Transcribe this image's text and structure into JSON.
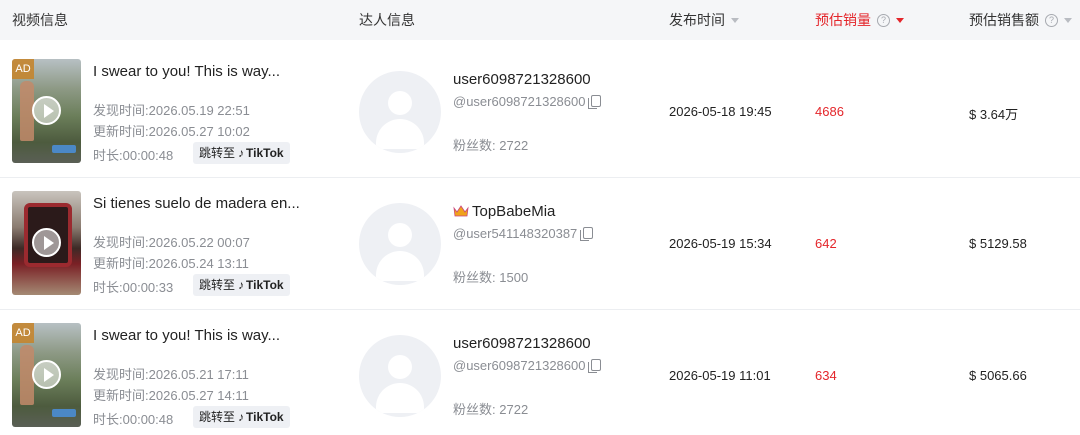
{
  "header": {
    "video_info": "视频信息",
    "creator_info": "达人信息",
    "publish_time": "发布时间",
    "est_sales": "预估销量",
    "est_gmv": "预估销售额",
    "help_icon": "question-circle-icon",
    "sort_icon": "caret-down-icon",
    "accent_color": "#e4262b"
  },
  "rows": [
    {
      "ad_badge": "AD",
      "title": "I swear to you! This is way...",
      "found_label": "发现时间:",
      "found_time": "2026.05.19 22:51",
      "updated_label": "更新时间:",
      "updated_time": "2026.05.27 10:02",
      "duration_label": "时长:",
      "duration": "00:00:48",
      "jump_label": "跳转至",
      "tiktok_label": "TikTok",
      "creator_name": "user6098721328600",
      "creator_id": "@user6098721328600",
      "fans_label": "粉丝数:",
      "fans": "2722",
      "publish_time": "2026-05-18 19:45",
      "sales": "4686",
      "gmv": "$ 3.64万"
    },
    {
      "ad_badge": "",
      "title": "Si tienes suelo de madera en...",
      "found_label": "发现时间:",
      "found_time": "2026.05.22 00:07",
      "updated_label": "更新时间:",
      "updated_time": "2026.05.24 13:11",
      "duration_label": "时长:",
      "duration": "00:00:33",
      "jump_label": "跳转至",
      "tiktok_label": "TikTok",
      "creator_name": "TopBabeMia",
      "creator_id": "@user541148320387",
      "fans_label": "粉丝数:",
      "fans": "1500",
      "publish_time": "2026-05-19 15:34",
      "sales": "642",
      "gmv": "$ 5129.58"
    },
    {
      "ad_badge": "AD",
      "title": "I swear to you! This is way...",
      "found_label": "发现时间:",
      "found_time": "2026.05.21 17:11",
      "updated_label": "更新时间:",
      "updated_time": "2026.05.27 14:11",
      "duration_label": "时长:",
      "duration": "00:00:48",
      "jump_label": "跳转至",
      "tiktok_label": "TikTok",
      "creator_name": "user6098721328600",
      "creator_id": "@user6098721328600",
      "fans_label": "粉丝数:",
      "fans": "2722",
      "publish_time": "2026-05-19 11:01",
      "sales": "634",
      "gmv": "$ 5065.66"
    }
  ]
}
